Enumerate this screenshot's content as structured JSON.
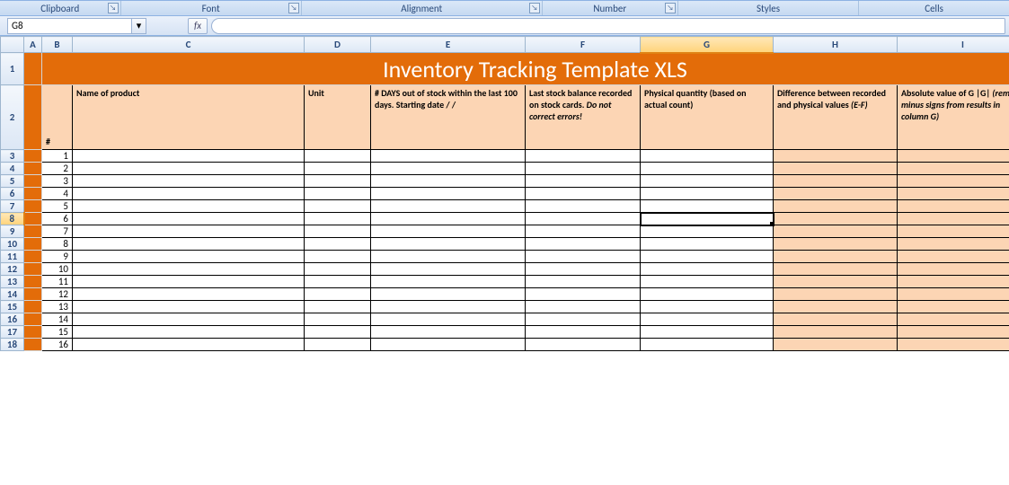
{
  "ribbon": {
    "groups": [
      "Clipboard",
      "Font",
      "Alignment",
      "Number",
      "Styles",
      "Cells"
    ]
  },
  "namebox": {
    "value": "G8"
  },
  "fx_label": "fx",
  "columns": [
    "A",
    "B",
    "C",
    "D",
    "E",
    "F",
    "G",
    "H",
    "I"
  ],
  "selected_col": "G",
  "selected_row": 8,
  "title": "Inventory Tracking Template XLS",
  "headers": {
    "num": "#",
    "name": "Name of product",
    "unit": "Unit",
    "days": "# DAYS out of stock within the last 100 days. Starting date   /  /",
    "last_a": "Last stock balance recorded on stock cards. ",
    "last_b": "Do not correct errors!",
    "phys": "Physical quantity (based on actual count)",
    "diff_a": "Difference between recorded and physical values ",
    "diff_b": "(E-F)",
    "abs_a": "Absolute value of G |G| ",
    "abs_b": "(remove minus signs from results in column G)"
  },
  "rows": [
    1,
    2,
    3,
    4,
    5,
    6,
    7,
    8,
    9,
    10,
    11,
    12,
    13,
    14,
    15,
    16
  ],
  "row_heights": {
    "1": 36,
    "2": 72
  }
}
